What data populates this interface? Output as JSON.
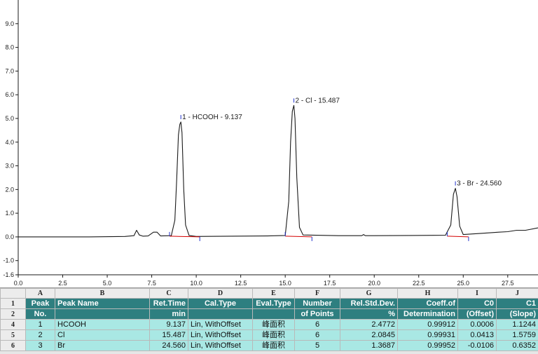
{
  "chart_data": {
    "type": "line",
    "title": "",
    "xlabel": "",
    "ylabel": "",
    "xlim": [
      0.0,
      29.2
    ],
    "ylim": [
      -1.6,
      10.0
    ],
    "x_ticks": [
      "0.0",
      "2.5",
      "5.0",
      "7.5",
      "10.0",
      "12.5",
      "15.0",
      "17.5",
      "20.0",
      "22.5",
      "25.0",
      "27.5"
    ],
    "y_ticks": [
      "-1.6",
      "-1.0",
      "0.0",
      "1.0",
      "2.0",
      "3.0",
      "4.0",
      "5.0",
      "6.0",
      "7.0",
      "8.0",
      "9.0"
    ],
    "series": [
      {
        "x": [
          0.0,
          2.0,
          4.0,
          6.0,
          6.5,
          6.65,
          6.8,
          7.0,
          7.3,
          7.6,
          7.8,
          8.0,
          8.6,
          8.8,
          8.9,
          9.0,
          9.08,
          9.137,
          9.2,
          9.3,
          9.4,
          9.6,
          10.0,
          12.0,
          14.0,
          15.0,
          15.2,
          15.3,
          15.4,
          15.487,
          15.55,
          15.65,
          15.8,
          16.0,
          18.0,
          19.3,
          19.4,
          19.5,
          20.0,
          22.0,
          24.0,
          24.3,
          24.45,
          24.56,
          24.65,
          24.8,
          25.0,
          26.0,
          27.0,
          27.5,
          28.0,
          28.5,
          29.2
        ],
        "y": [
          0.0,
          0.0,
          0.0,
          0.02,
          0.05,
          0.28,
          0.08,
          0.03,
          0.04,
          0.2,
          0.2,
          0.04,
          0.05,
          0.7,
          2.4,
          4.3,
          4.75,
          4.85,
          4.4,
          2.0,
          0.5,
          0.06,
          0.02,
          0.03,
          0.04,
          0.06,
          1.5,
          4.0,
          5.3,
          5.55,
          5.0,
          2.5,
          0.4,
          0.08,
          0.05,
          0.05,
          0.1,
          0.05,
          0.05,
          0.06,
          0.07,
          0.5,
          1.8,
          2.05,
          1.7,
          0.45,
          0.1,
          0.15,
          0.2,
          0.22,
          0.28,
          0.28,
          0.38
        ]
      }
    ],
    "peaks": [
      {
        "label": "1 - HCOOH - 9.137",
        "x": 9.137,
        "y": 4.85
      },
      {
        "label": "2 - Cl - 15.487",
        "x": 15.487,
        "y": 5.55
      },
      {
        "label": "3 - Br - 24.560",
        "x": 24.56,
        "y": 2.05
      }
    ],
    "baseline_segments": [
      [
        8.5,
        10.2
      ],
      [
        15.0,
        16.5
      ],
      [
        24.1,
        25.3
      ]
    ],
    "colors": {
      "trace": "#1a1a1a",
      "baseline": "#d40000",
      "marker": "#2233cc",
      "axis": "#1a1a1a"
    }
  },
  "sheet": {
    "columns": [
      "A",
      "B",
      "C",
      "D",
      "E",
      "F",
      "G",
      "H",
      "I",
      "J"
    ],
    "row_numbers": [
      "1",
      "2",
      "4",
      "5",
      "6"
    ],
    "header_top": [
      "Peak",
      "Peak Name",
      "Ret.Time",
      "Cal.Type",
      "Eval.Type",
      "Number",
      "Rel.Std.Dev.",
      "Coeff.of",
      "C0",
      "C1"
    ],
    "header_bottom": [
      "No.",
      "",
      "min",
      "",
      "",
      "of Points",
      "%",
      "Determination",
      "(Offset)",
      "(Slope)"
    ],
    "rows": [
      [
        "1",
        "HCOOH",
        "9.137",
        "Lin, WithOffset",
        "峰面积",
        "6",
        "2.4772",
        "0.99912",
        "0.0006",
        "1.1244"
      ],
      [
        "2",
        "Cl",
        "15.487",
        "Lin, WithOffset",
        "峰面积",
        "6",
        "2.0845",
        "0.99931",
        "0.0413",
        "1.5759"
      ],
      [
        "3",
        "Br",
        "24.560",
        "Lin, WithOffset",
        "峰面积",
        "5",
        "1.3687",
        "0.99952",
        "-0.0106",
        "0.6352"
      ]
    ],
    "colors": {
      "header_bg": "#2e7f80",
      "row_bg": "#a9e8e4"
    }
  }
}
